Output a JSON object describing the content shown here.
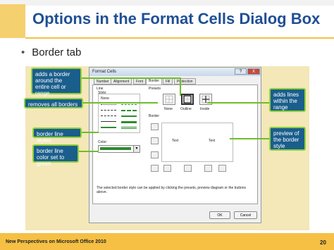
{
  "slide": {
    "title": "Options in the Format Cells Dialog Box",
    "bullet": "Border tab",
    "footer_text": "New Perspectives on Microsoft Office 2010",
    "page_number": "20"
  },
  "callouts": {
    "adds_border": "adds a border around the entire cell or range",
    "removes_borders": "removes all borders",
    "border_line_styles": "border line styles",
    "border_line_color": "border line color set to green",
    "adds_lines": "adds lines within the range",
    "preview": "preview of the border style"
  },
  "dialog": {
    "title": "Format Cells",
    "help_btn": "?",
    "close_btn": "X",
    "tabs": [
      "Number",
      "Alignment",
      "Font",
      "Border",
      "Fill",
      "Protection"
    ],
    "active_tab": "Border",
    "line_group": "Line",
    "style_label": "Style:",
    "none_style": "None",
    "color_label": "Color:",
    "presets_label": "Presets",
    "presets": [
      "None",
      "Outline",
      "Inside"
    ],
    "border_label": "Border",
    "preview_text_left": "Text",
    "preview_text_right": "Text",
    "description": "The selected border style can be applied by clicking the presets, preview diagram or the buttons above.",
    "ok": "OK",
    "cancel": "Cancel",
    "line_color": "#2e8b2e"
  },
  "colors": {
    "title": "#1f4f95",
    "callout_bg": "#1a5e8c",
    "callout_border": "#8fd03a",
    "arrow": "#6ebd2b",
    "accent_gold": "#f5c044"
  }
}
